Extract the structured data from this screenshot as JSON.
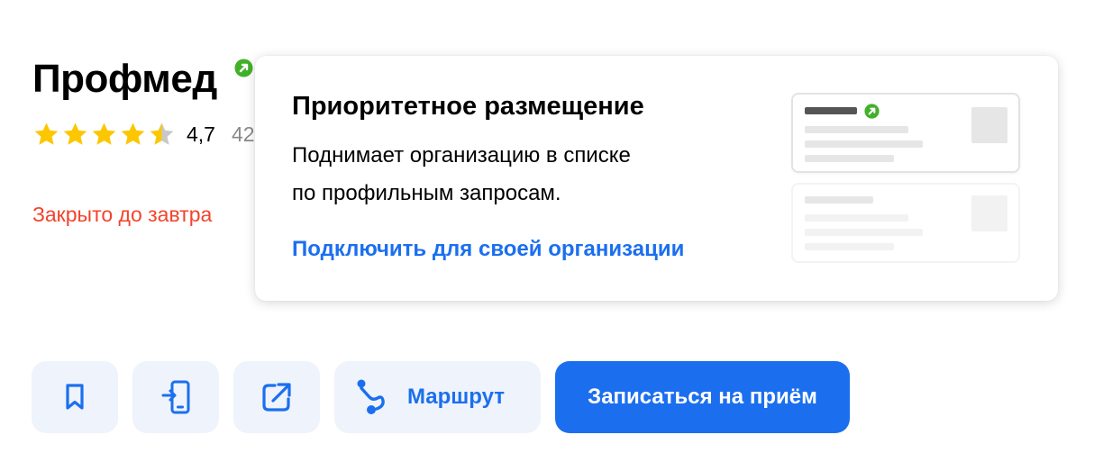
{
  "org": {
    "name": "Профмед",
    "rating": "4,7",
    "reviews_count": "42",
    "status": "Закрыто до завтра"
  },
  "popover": {
    "title": "Приоритетное размещение",
    "description_line1": "Поднимает организацию в списке",
    "description_line2": "по профильным запросам.",
    "link": "Подключить для своей организации"
  },
  "actions": {
    "bookmark_icon": "bookmark-icon",
    "phone_icon": "phone-icon",
    "share_icon": "share-icon",
    "route_icon": "route-icon",
    "route_label": "Маршрут",
    "book_label": "Записаться на приём"
  },
  "colors": {
    "accent": "#1b6fef",
    "verified": "#43b02a",
    "status": "#f5422b",
    "star": "#fcc700",
    "star_empty": "#c8c8c8",
    "button_bg": "#eff3fb"
  },
  "icons": {
    "verified": "verified-icon",
    "star": "star-icon"
  },
  "rating_stars": 4.5
}
